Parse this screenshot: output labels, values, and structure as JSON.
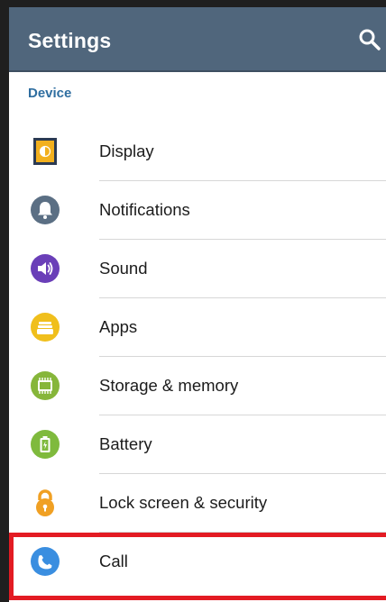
{
  "header": {
    "title": "Settings",
    "search_icon": "search-icon"
  },
  "section": {
    "title": "Device"
  },
  "items": [
    {
      "label": "Display",
      "icon": "display-icon"
    },
    {
      "label": "Notifications",
      "icon": "bell-icon"
    },
    {
      "label": "Sound",
      "icon": "speaker-icon"
    },
    {
      "label": "Apps",
      "icon": "apps-icon"
    },
    {
      "label": "Storage & memory",
      "icon": "memory-chip-icon"
    },
    {
      "label": "Battery",
      "icon": "battery-icon"
    },
    {
      "label": "Lock screen & security",
      "icon": "lock-icon"
    },
    {
      "label": "Call",
      "icon": "phone-icon"
    }
  ],
  "colors": {
    "appbar": "#50667c",
    "section_header": "#2f6ea0",
    "highlight": "#e31b23"
  }
}
